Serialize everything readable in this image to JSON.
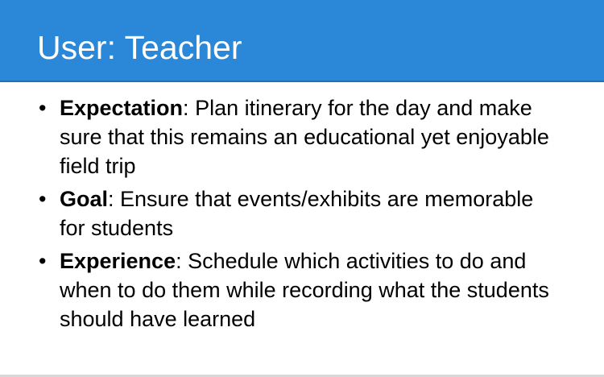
{
  "slide": {
    "title": "User: Teacher",
    "bullets": [
      {
        "term": "Expectation",
        "separator": ":",
        "text": " Plan itinerary for the day and make sure that this remains an educational yet enjoyable field trip"
      },
      {
        "term": "Goal",
        "separator": ":",
        "text": " Ensure that events/exhibits are memorable for students"
      },
      {
        "term": "Experience",
        "separator": ":",
        "text": " Schedule which activities to do and when to do them while recording what the students should have learned"
      }
    ],
    "bullet_glyph": "•",
    "colors": {
      "title_bar": "#2b88d8",
      "title_text": "#ffffff",
      "body_text": "#000000",
      "background": "#ffffff"
    }
  }
}
